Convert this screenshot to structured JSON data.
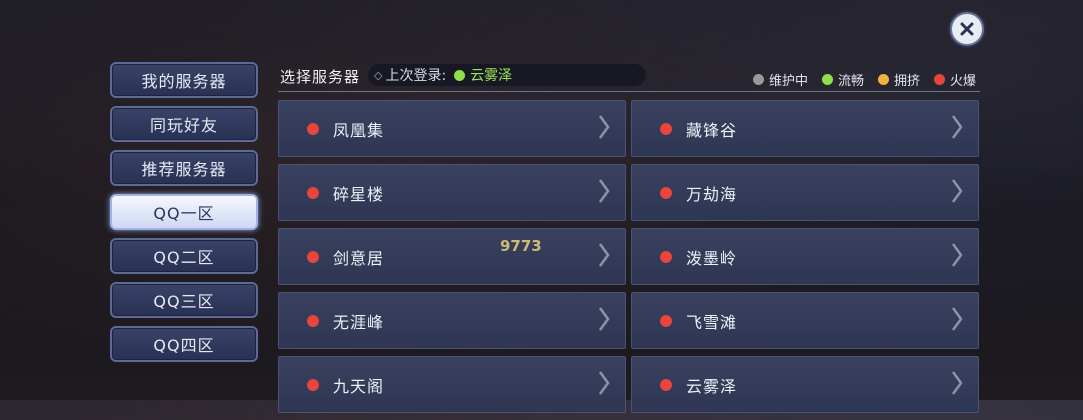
{
  "sidebar": {
    "tabs": [
      {
        "label": "我的服务器",
        "active": false
      },
      {
        "label": "同玩好友",
        "active": false
      },
      {
        "label": "推荐服务器",
        "active": false
      },
      {
        "label": "QQ一区",
        "active": true
      },
      {
        "label": "QQ二区",
        "active": false
      },
      {
        "label": "QQ三区",
        "active": false
      },
      {
        "label": "QQ四区",
        "active": false
      }
    ]
  },
  "header": {
    "title": "选择服务器",
    "last_login_label": "上次登录:",
    "last_login_server": "云雾泽",
    "last_login_status_color": "#8fe04a"
  },
  "legend": [
    {
      "label": "维护中",
      "color": "#9a9a9a"
    },
    {
      "label": "流畅",
      "color": "#8fe04a"
    },
    {
      "label": "拥挤",
      "color": "#f0b43c"
    },
    {
      "label": "火爆",
      "color": "#e8453c"
    }
  ],
  "servers": [
    {
      "name": "凤凰集",
      "status_color": "#e8453c"
    },
    {
      "name": "藏锋谷",
      "status_color": "#e8453c"
    },
    {
      "name": "碎星楼",
      "status_color": "#e8453c"
    },
    {
      "name": "万劫海",
      "status_color": "#e8453c"
    },
    {
      "name": "剑意居",
      "status_color": "#e8453c"
    },
    {
      "name": "泼墨岭",
      "status_color": "#e8453c"
    },
    {
      "name": "无涯峰",
      "status_color": "#e8453c"
    },
    {
      "name": "飞雪滩",
      "status_color": "#e8453c"
    },
    {
      "name": "九天阁",
      "status_color": "#e8453c"
    },
    {
      "name": "云雾泽",
      "status_color": "#e8453c"
    }
  ],
  "watermark": "9773"
}
